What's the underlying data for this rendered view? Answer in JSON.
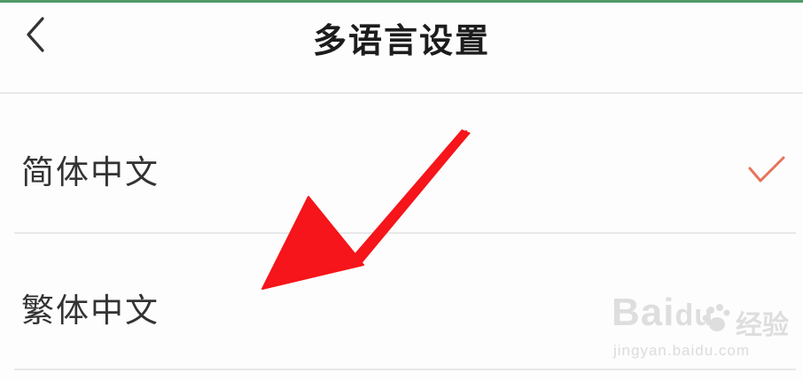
{
  "header": {
    "back_icon": "chevron-left-icon",
    "title": "多语言设置"
  },
  "languages": [
    {
      "label": "简体中文",
      "selected": true
    },
    {
      "label": "繁体中文",
      "selected": false
    }
  ],
  "check_icon": "checkmark-icon",
  "accent_color": "#e8735a",
  "annotation": {
    "arrow_color": "#f5151a"
  },
  "watermark": {
    "brand": "Bai",
    "brand_suffix": "du",
    "product": "经验",
    "url": "jingyan.baidu.com"
  }
}
